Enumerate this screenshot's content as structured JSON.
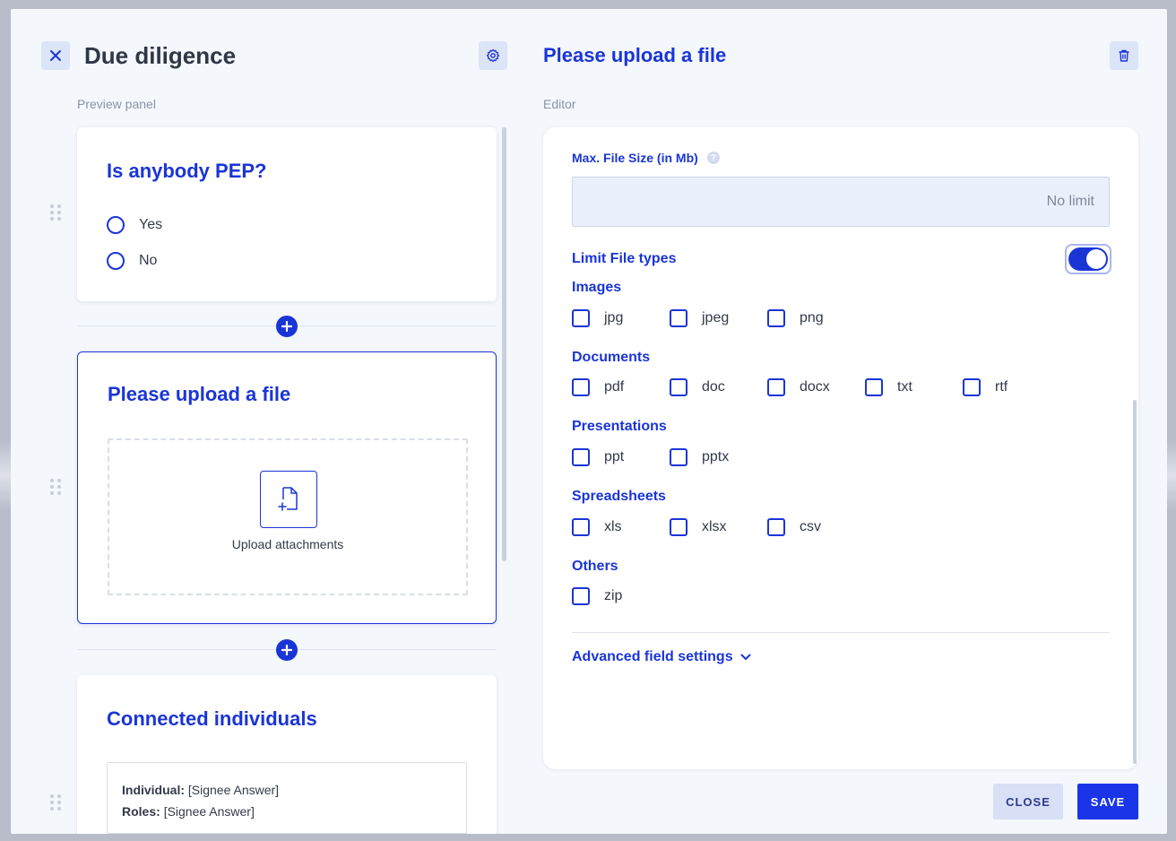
{
  "header": {
    "title": "Due diligence",
    "editor_title": "Please upload a file"
  },
  "labels": {
    "preview_panel": "Preview panel",
    "editor": "Editor"
  },
  "preview": {
    "pep_card": {
      "title": "Is anybody PEP?",
      "options": [
        "Yes",
        "No"
      ]
    },
    "upload_card": {
      "title": "Please upload a file",
      "upload_text": "Upload attachments"
    },
    "connected_card": {
      "title": "Connected individuals",
      "individual_label": "Individual:",
      "individual_value": "[Signee Answer]",
      "roles_label": "Roles:",
      "roles_value": "[Signee Answer]"
    }
  },
  "editor": {
    "max_size_label": "Max. File Size (in Mb)",
    "help_glyph": "?",
    "max_size_placeholder": "No limit",
    "max_size_value": "",
    "limit_types_label": "Limit File types",
    "limit_types_enabled": true,
    "groups": [
      {
        "label": "Images",
        "types": [
          "jpg",
          "jpeg",
          "png"
        ]
      },
      {
        "label": "Documents",
        "types": [
          "pdf",
          "doc",
          "docx",
          "txt",
          "rtf"
        ]
      },
      {
        "label": "Presentations",
        "types": [
          "ppt",
          "pptx"
        ]
      },
      {
        "label": "Spreadsheets",
        "types": [
          "xls",
          "xlsx",
          "csv"
        ]
      },
      {
        "label": "Others",
        "types": [
          "zip"
        ]
      }
    ],
    "advanced_label": "Advanced field settings"
  },
  "footer": {
    "close_label": "CLOSE",
    "save_label": "SAVE"
  },
  "colors": {
    "accent": "#1a35d6",
    "save_bg": "#1a35e8",
    "close_bg": "#d8e0f6",
    "modal_bg": "#f4f7fc"
  }
}
